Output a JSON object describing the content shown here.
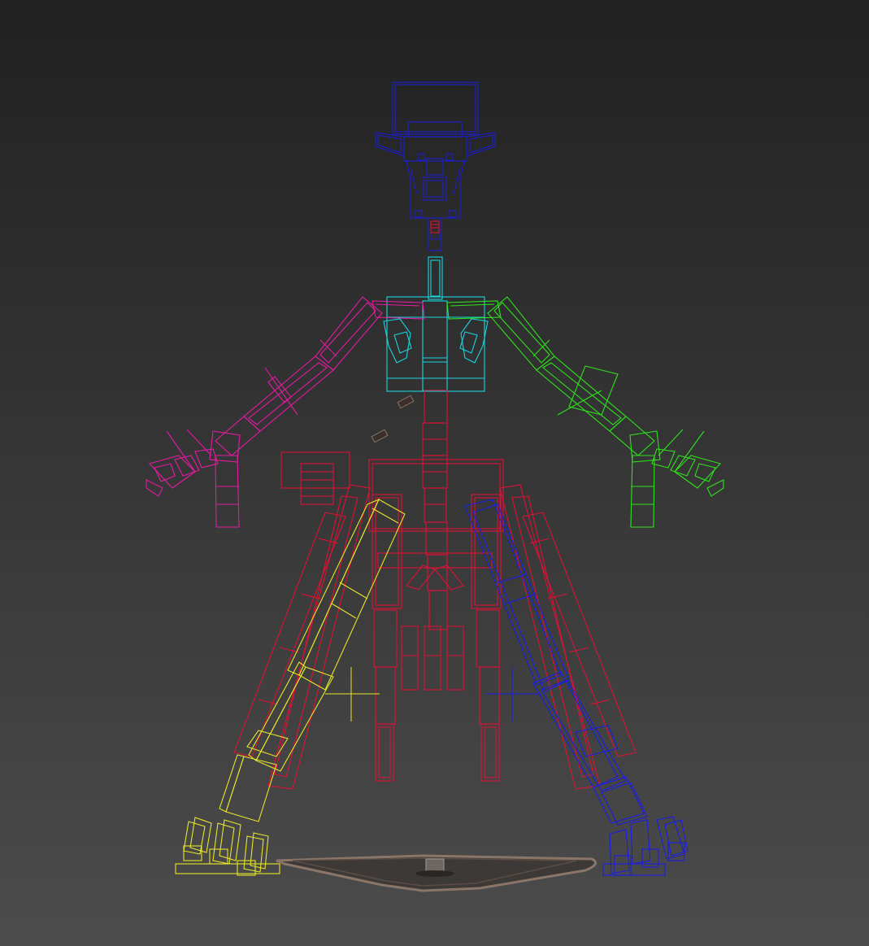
{
  "viewport": {
    "background_top": "#212121",
    "background_bottom": "#4c4c4c"
  },
  "rig_colors": {
    "head": "#1b1ed0",
    "spine": "#19d6de",
    "left_arm": "#e61aa4",
    "right_arm": "#2ee21b",
    "left_leg": "#e8e52a",
    "right_leg": "#1a1ee6",
    "pelvis_legs": "#dc1236",
    "base_plate": "#8a7668"
  },
  "icons": [
    "left-leg-ik-crosshair-icon",
    "right-leg-ik-crosshair-icon"
  ]
}
